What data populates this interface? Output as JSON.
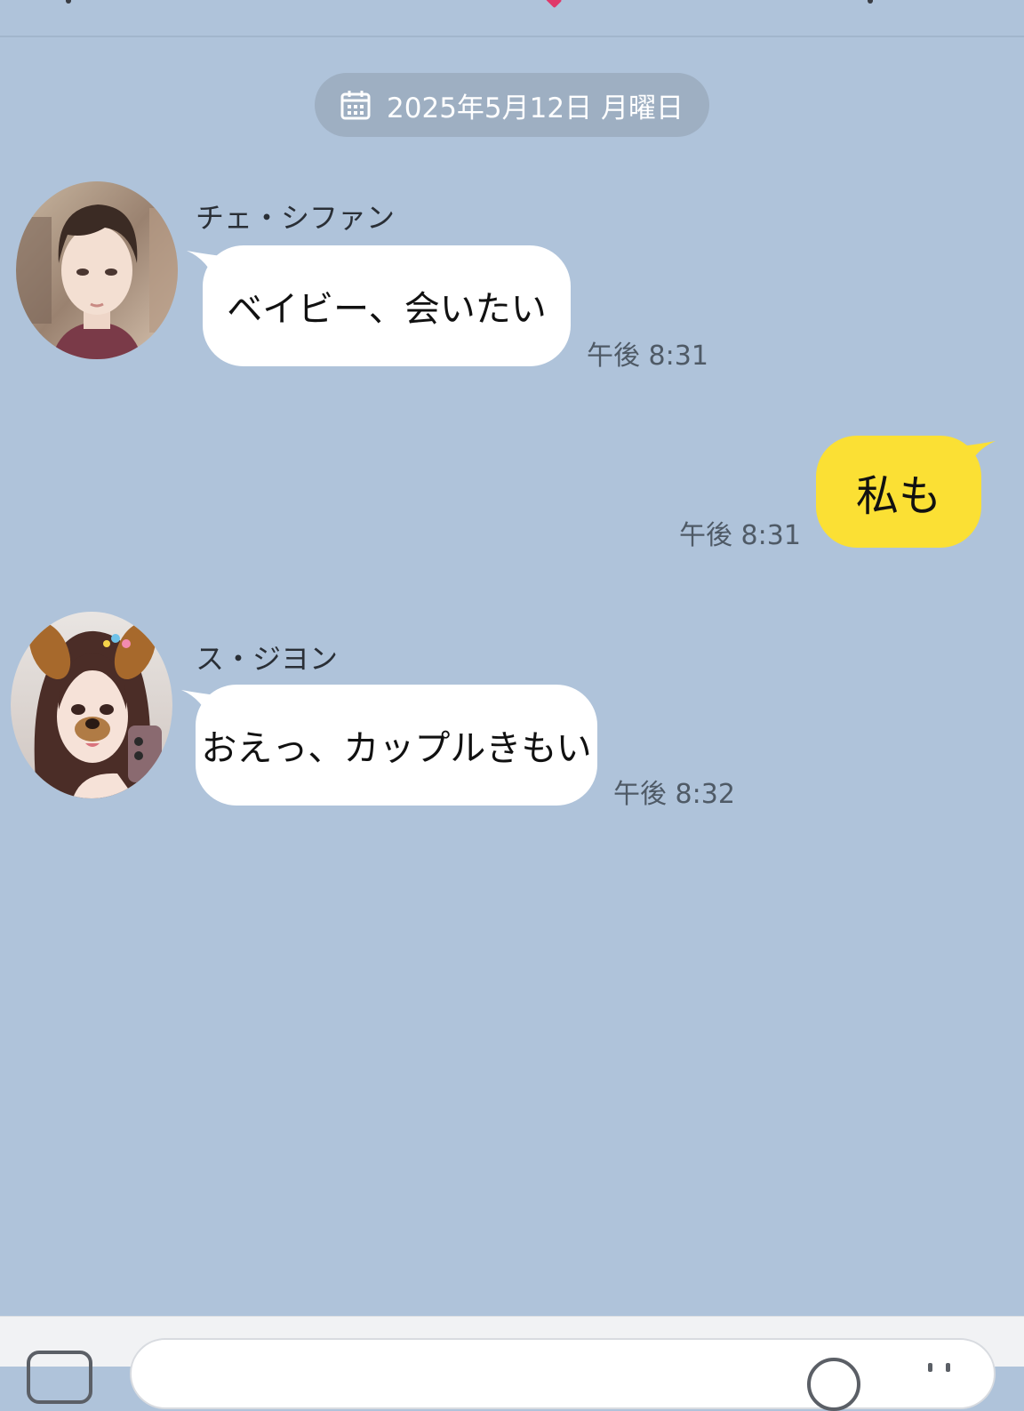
{
  "date_divider": {
    "label": "2025年5月12日 月曜日",
    "icon": "calendar-icon"
  },
  "messages": [
    {
      "sender": "チェ・シファン",
      "text": "ベイビー、会いたい",
      "time": "午後 8:31",
      "avatar": "avatar-male"
    },
    {
      "sender": "",
      "text": "私も",
      "time": "午後 8:31",
      "outgoing": true
    },
    {
      "sender": "ス・ジヨン",
      "text": "おえっ、カップルきもい",
      "time": "午後 8:32",
      "avatar": "avatar-female"
    }
  ],
  "colors": {
    "background": "#afc3da",
    "incoming_bubble": "#ffffff",
    "outgoing_bubble": "#fbe034",
    "date_pill": "#9eafc2"
  },
  "input_bar": {
    "plus_icon": "plus-icon",
    "emoji_icon": "emoji-icon",
    "more_icon": "more-icon"
  }
}
